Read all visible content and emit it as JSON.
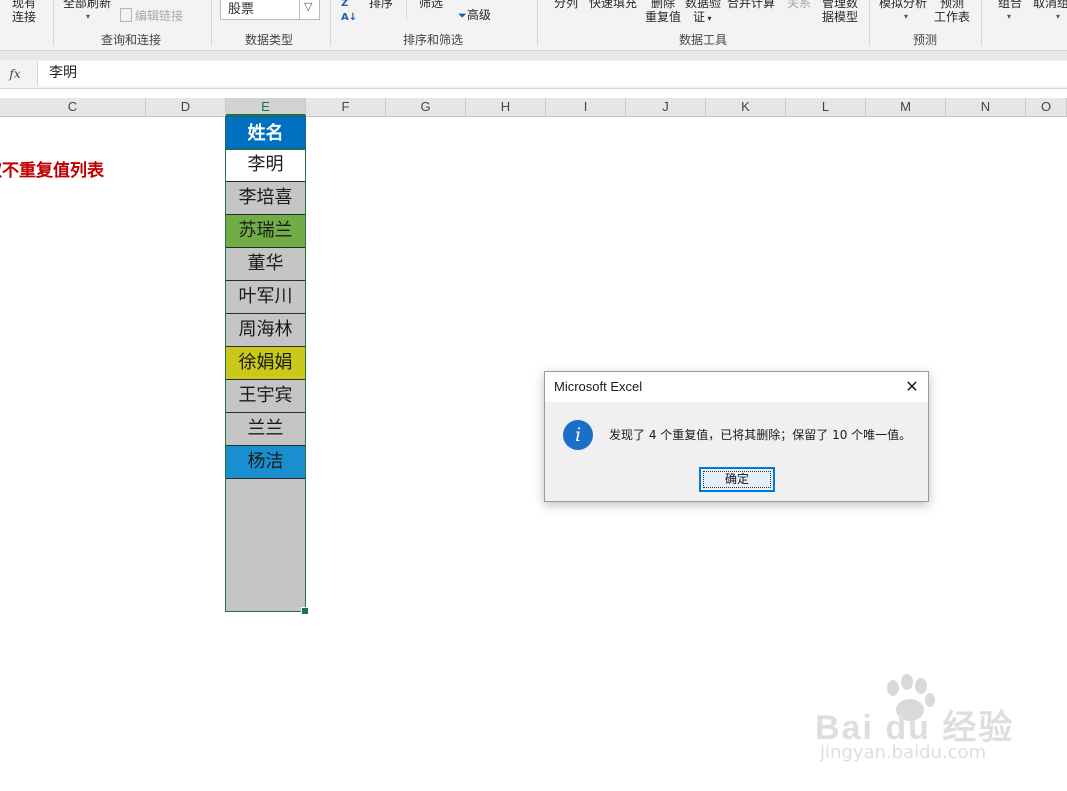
{
  "ribbon": {
    "items": {
      "existing_connections": [
        "现有",
        "连接"
      ],
      "refresh_all": "全部刷新",
      "edit_links": "编辑链接",
      "sort": "排序",
      "filter": "筛选",
      "advanced": "高级",
      "text_to_columns": "分列",
      "flash_fill": "快速填充",
      "remove_duplicates": [
        "删除",
        "重复值"
      ],
      "data_validation": [
        "数据验",
        "证"
      ],
      "consolidate": "合并计算",
      "relationships": "关系",
      "manage_data_model": [
        "管理数",
        "据模型"
      ],
      "what_if": "模拟分析",
      "forecast_sheet": [
        "预测",
        "工作表"
      ],
      "group": "组合",
      "ungroup": "取消组"
    },
    "datatype_value": "股票",
    "groups": {
      "queries_connections": "查询和连接",
      "data_types": "数据类型",
      "sort_filter": "排序和筛选",
      "data_tools": "数据工具",
      "forecast": "预测"
    }
  },
  "formula_bar": {
    "fx_label": "fx",
    "value": "李明"
  },
  "columns": [
    "C",
    "D",
    "E",
    "F",
    "G",
    "H",
    "I",
    "J",
    "K",
    "L",
    "M",
    "N",
    "O"
  ],
  "selected_column": "E",
  "sheet": {
    "title": "取不重复值列表",
    "name_header": "姓名",
    "names": [
      {
        "name": "李明",
        "fill": "#ffffff"
      },
      {
        "name": "李培喜",
        "fill": "#c5c5c5"
      },
      {
        "name": "苏瑞兰",
        "fill": "#70ad47"
      },
      {
        "name": "董华",
        "fill": "#c5c5c5"
      },
      {
        "name": "叶军川",
        "fill": "#c5c5c5"
      },
      {
        "name": "周海林",
        "fill": "#c5c5c5"
      },
      {
        "name": "徐娟娟",
        "fill": "#c9c91a"
      },
      {
        "name": "王宇宾",
        "fill": "#c5c5c5"
      },
      {
        "name": "兰兰",
        "fill": "#c5c5c5"
      },
      {
        "name": "杨洁",
        "fill": "#1a8fd0"
      }
    ]
  },
  "dialog": {
    "title": "Microsoft Excel",
    "message": "发现了 4 个重复值，已将其删除；保留了 10 个唯一值。",
    "ok_label": "确定",
    "close_glyph": "✕",
    "icon": "info-icon"
  },
  "watermark": {
    "brand": "Bai du 经验",
    "url": "jingyan.baidu.com"
  }
}
